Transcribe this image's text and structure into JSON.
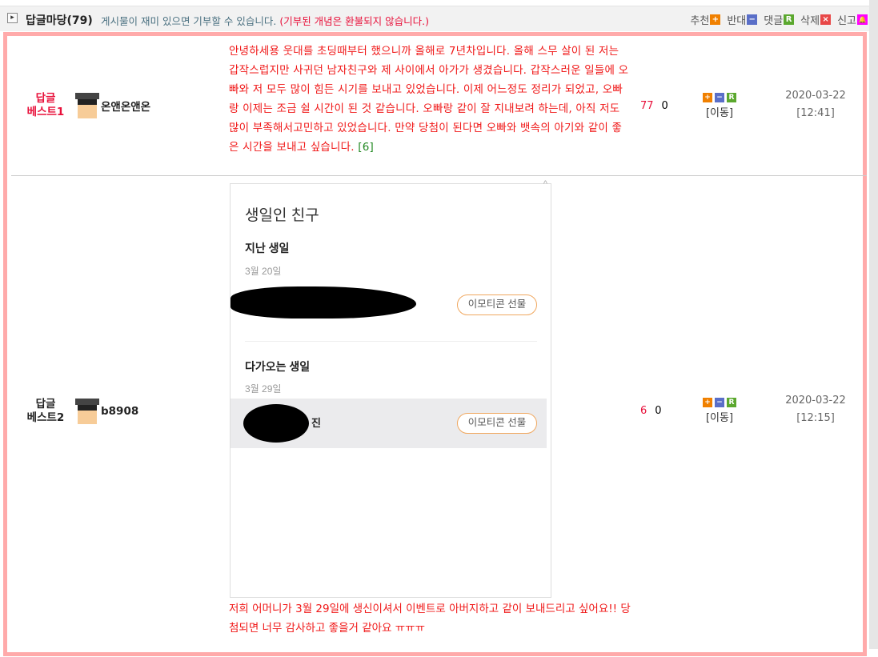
{
  "header": {
    "expand_icon": "▸",
    "title": "답글마당(79)",
    "subtitle": "게시물이 재미 있으면 기부할 수 있습니다.",
    "warning": "(기부된 개념은 환불되지 않습니다.)",
    "actions": [
      {
        "label": "추천",
        "icon": "+",
        "color": "#f08000"
      },
      {
        "label": "반대",
        "icon": "−",
        "color": "#5a6fc8"
      },
      {
        "label": "댓글",
        "icon": "R",
        "color": "#5ba82e"
      },
      {
        "label": "삭제",
        "icon": "×",
        "color": "#e84848"
      },
      {
        "label": "신고",
        "icon": "🔔",
        "color": "#ff00ff"
      }
    ]
  },
  "posts": [
    {
      "rank_line1": "답글",
      "rank_line2": "베스트1",
      "rank_color": "#e8103a",
      "user": "온앤온앤온",
      "content": "안녕하세용 웃대를 초딩때부터 했으니까 올해로 7년차입니다. 올해 스무 살이 된 저는 갑작스럽지만 사귀던 남자친구와 제 사이에서 아가가 생겼습니다. 갑작스러운 일들에 오빠와 저 모두 많이 힘든 시기를 보내고 있었습니다. 이제 어느정도 정리가 되었고, 오빠랑 이제는 조금 쉴 시간이 된 것 같습니다. 오빠랑 같이 잘 지내보려 하는데, 아직 저도 많이 부족해서고민하고 있었습니다. 만약 당첨이 된다면 오빠와 뱃속의 아기와 같이 좋은 시간을 보내고 싶습니다.",
      "comment_count": "[6]",
      "up": "77",
      "down": "0",
      "move": "[이동]",
      "date": "2020-03-22",
      "time": "[12:41]"
    },
    {
      "rank_line1": "답글",
      "rank_line2": "베스트2",
      "rank_color": "#222222",
      "user": "b8908",
      "image": {
        "title": "생일인 친구",
        "past_label": "지난 생일",
        "past_date": "3월 20일",
        "gift_label": "이모티콘 선물",
        "upcoming_label": "다가오는 생일",
        "upcoming_date": "3월 29일",
        "upcoming_name_suffix": "진",
        "close": "^"
      },
      "content": "저희 어머니가 3월 29일에 생신이셔서 이벤트로 아버지하고 같이 보내드리고 싶어요!! 당첨되면 너무 감사하고 좋을거 같아요 ㅠㅠㅠ",
      "up": "6",
      "down": "0",
      "move": "[이동]",
      "date": "2020-03-22",
      "time": "[12:15]"
    }
  ]
}
